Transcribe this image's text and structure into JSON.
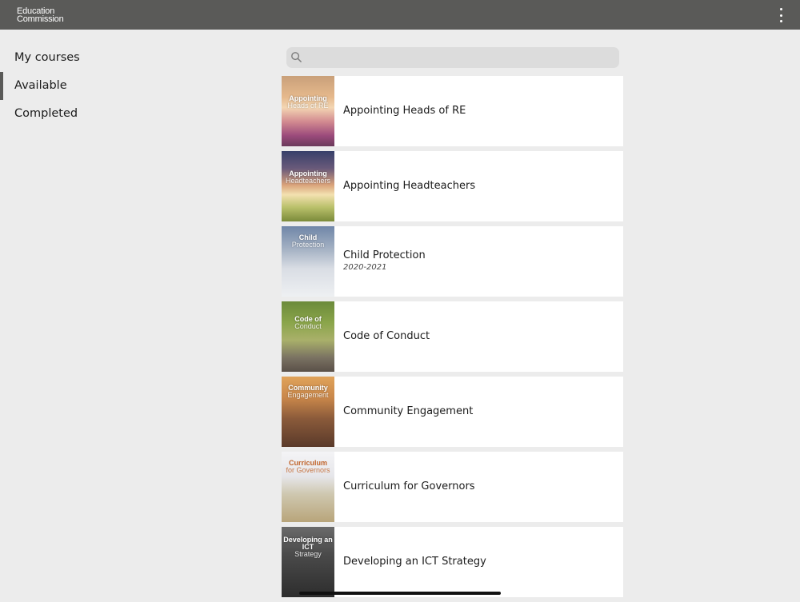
{
  "header": {
    "logo_line1": "Education",
    "logo_line2": "Commission",
    "menu_icon": "more-vertical-icon"
  },
  "sidebar": {
    "items": [
      {
        "label": "My courses",
        "active": false
      },
      {
        "label": "Available",
        "active": true
      },
      {
        "label": "Completed",
        "active": false
      }
    ]
  },
  "search": {
    "placeholder": "",
    "value": "",
    "icon": "search-icon"
  },
  "courses": [
    {
      "title": "Appointing Heads of RE",
      "subtitle": "",
      "thumb_line1": "Appointing",
      "thumb_line2": "Heads of RE"
    },
    {
      "title": "Appointing Headteachers",
      "subtitle": "",
      "thumb_line1": "Appointing",
      "thumb_line2": "Headteachers"
    },
    {
      "title": "Child Protection",
      "subtitle": "2020-2021",
      "thumb_line1": "Child",
      "thumb_line2": "Protection"
    },
    {
      "title": "Code of Conduct",
      "subtitle": "",
      "thumb_line1": "Code of",
      "thumb_line2": "Conduct"
    },
    {
      "title": "Community Engagement",
      "subtitle": "",
      "thumb_line1": "Community",
      "thumb_line2": "Engagement"
    },
    {
      "title": "Curriculum for Governors",
      "subtitle": "",
      "thumb_line1": "Curriculum",
      "thumb_line2": "for Governors"
    },
    {
      "title": "Developing an ICT Strategy",
      "subtitle": "",
      "thumb_line1": "Developing an ICT",
      "thumb_line2": "Strategy"
    }
  ],
  "colors": {
    "header_bg": "#5a5a58",
    "page_bg": "#ececec",
    "active_indicator": "#5a5a58"
  }
}
